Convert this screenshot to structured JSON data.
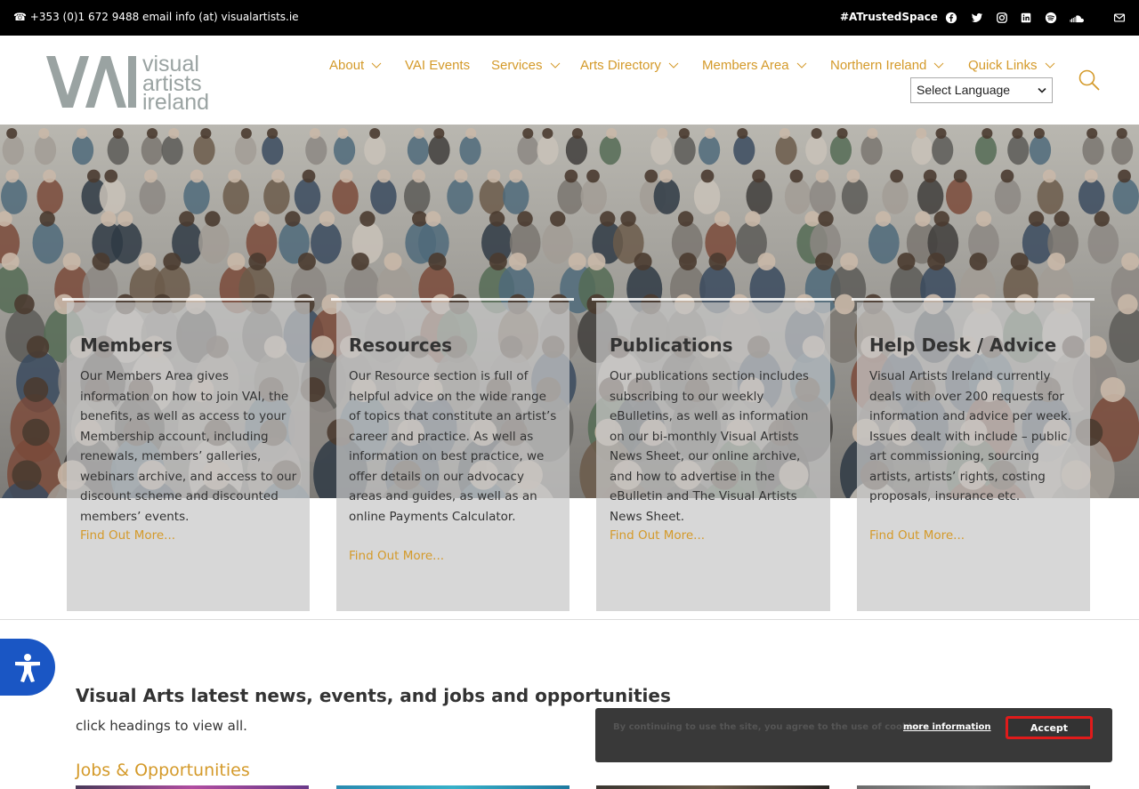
{
  "topbar": {
    "contact": "☎ +353 (0)1 672 9488 email info (at) visualartists.ie",
    "hashtag": "#ATrustedSpace",
    "social_icons": [
      "facebook-icon",
      "twitter-icon",
      "instagram-icon",
      "linkedin-icon",
      "spotify-icon",
      "soundcloud-icon",
      "email-icon"
    ]
  },
  "logo": {
    "mark": "VAI",
    "line1": "visual",
    "line2": "artists",
    "line3": "ireland"
  },
  "nav": {
    "items": [
      {
        "label": "About",
        "has_dropdown": true
      },
      {
        "label": "VAI Events",
        "has_dropdown": false
      },
      {
        "label": "Services",
        "has_dropdown": true
      },
      {
        "label": "Arts Directory",
        "has_dropdown": true
      },
      {
        "label": "Members Area",
        "has_dropdown": true
      },
      {
        "label": "Northern Ireland",
        "has_dropdown": true
      },
      {
        "label": "Quick Links",
        "has_dropdown": true
      }
    ],
    "language_select": "Select Language"
  },
  "cards": [
    {
      "title": "Members",
      "body": "Our Members Area gives information on how to join VAI, the benefits, as well as access to your Membership account, including renewals, members’ galleries, webinars archive, and access to our discount scheme and discounted members’ events.",
      "link": "Find Out More..."
    },
    {
      "title": "Resources",
      "body": "Our Resource section is full of helpful advice on the wide range of topics that constitute an artist’s career and practice. As well as information on best practice, we offer details on our advocacy areas and guides, as well as an online Payments Calculator.",
      "link": "Find Out More..."
    },
    {
      "title": "Publications",
      "body": "Our publications section includes subscribing to our weekly eBulletins, as well as information on our bi-monthly Visual Artists News Sheet, our online archive, and how to advertise in the eBulletin and The Visual Artists News Sheet.",
      "link": "Find Out More..."
    },
    {
      "title": "Help Desk / Advice",
      "body": "Visual Artists Ireland currently deals with over 200 requests for information and advice per week. Issues dealt with include – public art commissioning, sourcing artists, artists’ rights, costing proposals, insurance etc.",
      "link": "Find Out More..."
    }
  ],
  "news": {
    "title": "Visual Arts latest news, events, and jobs and opportunities",
    "subtitle": "click headings to view all.",
    "jobs_heading": "Jobs & Opportunities"
  },
  "cookie": {
    "message": "By continuing to use the site, you agree to the use of cookies.",
    "more": "more information",
    "accept": "Accept"
  },
  "colors": {
    "accent": "#d49a2a",
    "topbar": "#000000",
    "a11y": "#1a56c4",
    "cookie_accept_border": "#e01b1b"
  }
}
